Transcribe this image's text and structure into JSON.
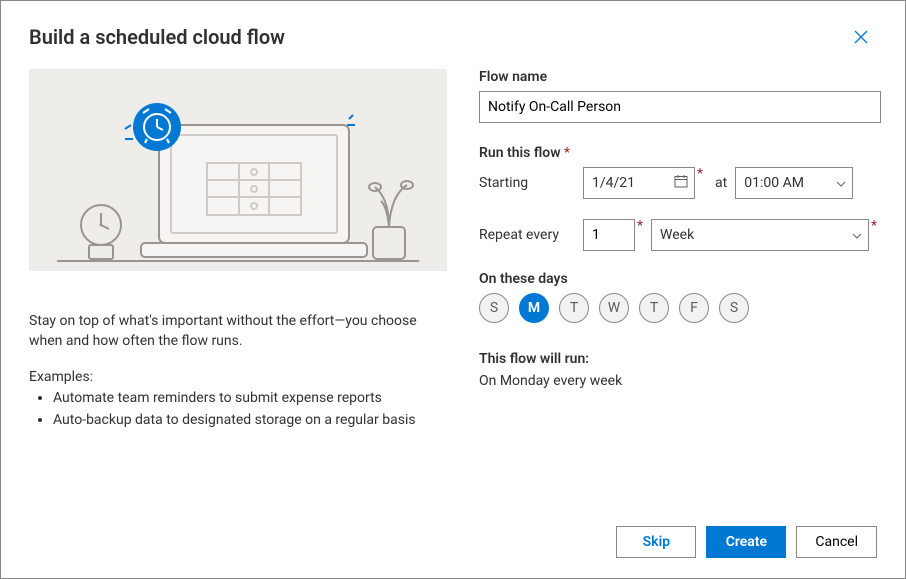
{
  "title": "Build a scheduled cloud flow",
  "left": {
    "description": "Stay on top of what's important without the effort—you choose when and how often the flow runs.",
    "examples_heading": "Examples:",
    "examples": [
      "Automate team reminders to submit expense reports",
      "Auto-backup data to designated storage on a regular basis"
    ]
  },
  "form": {
    "flow_name_label": "Flow name",
    "flow_name_value": "Notify On-Call Person",
    "run_heading": "Run this flow",
    "starting_label": "Starting",
    "start_date": "1/4/21",
    "at_label": "at",
    "start_time": "01:00 AM",
    "repeat_label": "Repeat every",
    "repeat_value": "1",
    "repeat_unit": "Week",
    "days_label": "On these days",
    "days": [
      {
        "abbr": "S",
        "selected": false
      },
      {
        "abbr": "M",
        "selected": true
      },
      {
        "abbr": "T",
        "selected": false
      },
      {
        "abbr": "W",
        "selected": false
      },
      {
        "abbr": "T",
        "selected": false
      },
      {
        "abbr": "F",
        "selected": false
      },
      {
        "abbr": "S",
        "selected": false
      }
    ],
    "will_run_label": "This flow will run:",
    "will_run_text": "On Monday every week"
  },
  "buttons": {
    "skip": "Skip",
    "create": "Create",
    "cancel": "Cancel"
  }
}
